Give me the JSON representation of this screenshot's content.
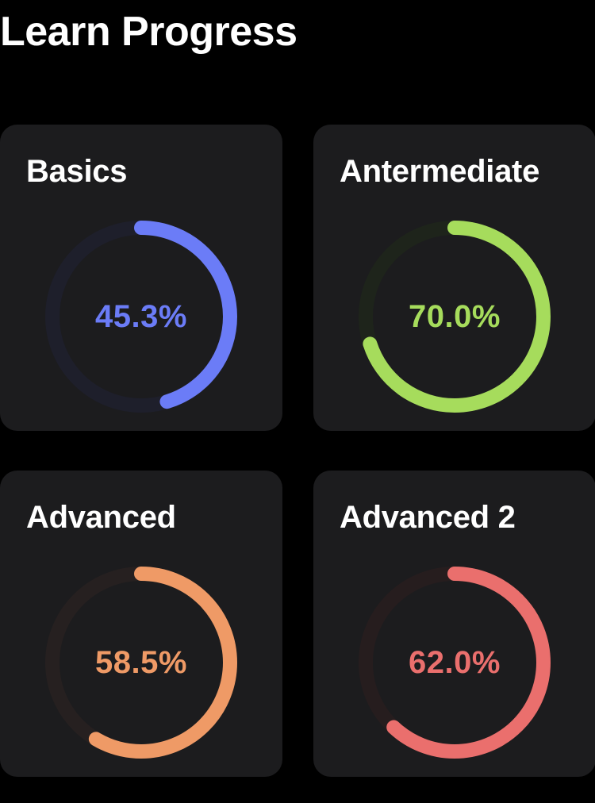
{
  "header": {
    "title": "Learn Progress"
  },
  "cards": [
    {
      "title": "Basics",
      "percent_label": "45.3%",
      "progress": 0.453,
      "color": "#6b7cf7",
      "track_color": "#1e1f2b"
    },
    {
      "title": "Antermediate",
      "percent_label": "70.0%",
      "progress": 0.7,
      "color": "#a6dc5c",
      "track_color": "#1e241b"
    },
    {
      "title": "Advanced",
      "percent_label": "58.5%",
      "progress": 0.585,
      "color": "#ef9a66",
      "track_color": "#262020"
    },
    {
      "title": "Advanced 2",
      "percent_label": "62.0%",
      "progress": 0.62,
      "color": "#ea6f6d",
      "track_color": "#261d1e"
    }
  ]
}
